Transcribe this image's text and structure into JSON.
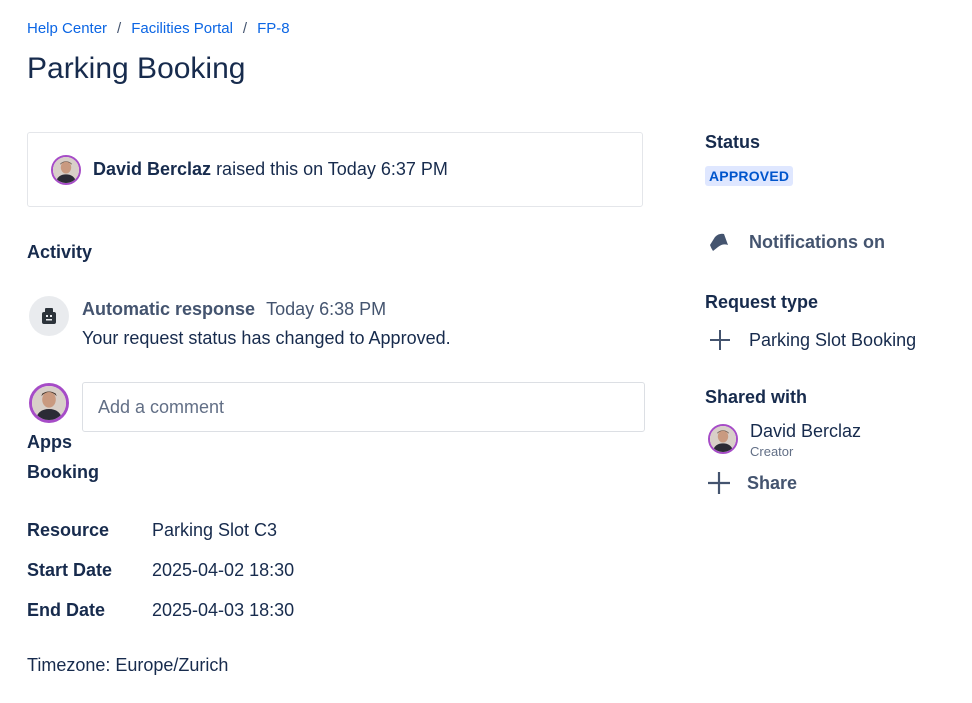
{
  "breadcrumb": {
    "items": [
      "Help Center",
      "Facilities Portal",
      "FP-8"
    ],
    "separator": "/"
  },
  "page_title": "Parking Booking",
  "raised": {
    "name": "David Berclaz",
    "text": "raised this on Today 6:37 PM"
  },
  "activity": {
    "heading": "Activity",
    "item": {
      "author": "Automatic response",
      "time": "Today 6:38 PM",
      "message": "Your request status has changed to Approved.",
      "icon": "robot-icon"
    }
  },
  "comment": {
    "placeholder": "Add a comment"
  },
  "apps": {
    "label": "Apps",
    "booking_label": "Booking"
  },
  "booking_fields": [
    {
      "label": "Resource",
      "value": "Parking Slot C3"
    },
    {
      "label": "Start Date",
      "value": "2025-04-02 18:30"
    },
    {
      "label": "End Date",
      "value": "2025-04-03 18:30"
    }
  ],
  "timezone": "Timezone: Europe/Zurich",
  "sidebar": {
    "status_heading": "Status",
    "status_value": "APPROVED",
    "notifications_label": "Notifications on",
    "request_type_heading": "Request type",
    "request_type_value": "Parking Slot Booking",
    "shared_heading": "Shared with",
    "shared_name": "David Berclaz",
    "shared_role": "Creator",
    "share_label": "Share"
  },
  "colors": {
    "link": "#0c66e4",
    "text": "#172b4d",
    "badge_bg": "#dfe7ff",
    "badge_text": "#0055cc",
    "avatar_ring": "#a64cc7"
  }
}
